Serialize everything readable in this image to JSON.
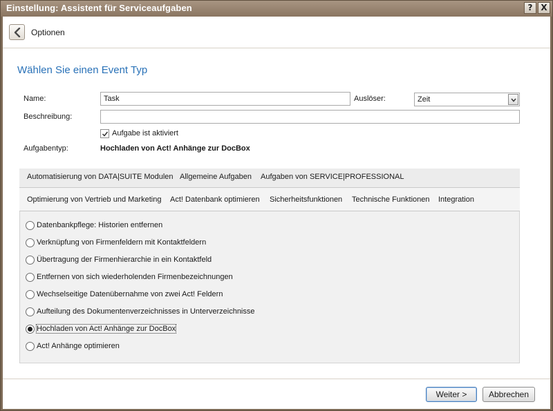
{
  "window": {
    "title": "Einstellung: Assistent für Serviceaufgaben",
    "help_glyph": "?",
    "close_glyph": "X"
  },
  "header": {
    "back_icon": "chevron-left-icon",
    "label": "Optionen"
  },
  "heading": "Wählen Sie einen Event Typ",
  "form": {
    "name_label": "Name:",
    "name_value": "Task",
    "trigger_label": "Auslöser:",
    "trigger_value": "Zeit",
    "description_label": "Beschreibung:",
    "description_value": "",
    "active_checked": true,
    "active_label": "Aufgabe ist aktiviert",
    "task_type_label": "Aufgabentyp:",
    "task_type_value": "Hochladen von Act! Anhänge zur DocBox"
  },
  "tabs_row1": [
    {
      "label": "Automatisierung von DATA|SUITE Modulen"
    },
    {
      "label": "Allgemeine Aufgaben"
    },
    {
      "label": "Aufgaben von SERVICE|PROFESSIONAL"
    }
  ],
  "tabs_row2": [
    {
      "label": "Optimierung von Vertrieb und Marketing"
    },
    {
      "label": "Act! Datenbank optimieren",
      "selected": true
    },
    {
      "label": "Sicherheitsfunktionen"
    },
    {
      "label": "Technische Funktionen"
    },
    {
      "label": "Integration"
    }
  ],
  "options": [
    {
      "label": "Datenbankpflege: Historien entfernen",
      "checked": false
    },
    {
      "label": "Verknüpfung von Firmenfeldern mit Kontaktfeldern",
      "checked": false
    },
    {
      "label": "Übertragung der Firmenhierarchie in ein Kontaktfeld",
      "checked": false
    },
    {
      "label": "Entfernen von sich wiederholenden Firmenbezeichnungen",
      "checked": false
    },
    {
      "label": "Wechselseitige Datenübernahme von zwei Act! Feldern",
      "checked": false
    },
    {
      "label": "Aufteilung des Dokumentenverzeichnisses in Unterverzeichnisse",
      "checked": false
    },
    {
      "label": "Hochladen von Act! Anhänge zur DocBox",
      "checked": true
    },
    {
      "label": "Act! Anhänge optimieren",
      "checked": false
    }
  ],
  "footer": {
    "next_label": "Weiter >",
    "cancel_label": "Abbrechen"
  },
  "colors": {
    "title_bar": "#8a7561",
    "heading": "#2a72b8",
    "tab_bg": "#ececec",
    "panel_bg": "#f1f1f1"
  }
}
